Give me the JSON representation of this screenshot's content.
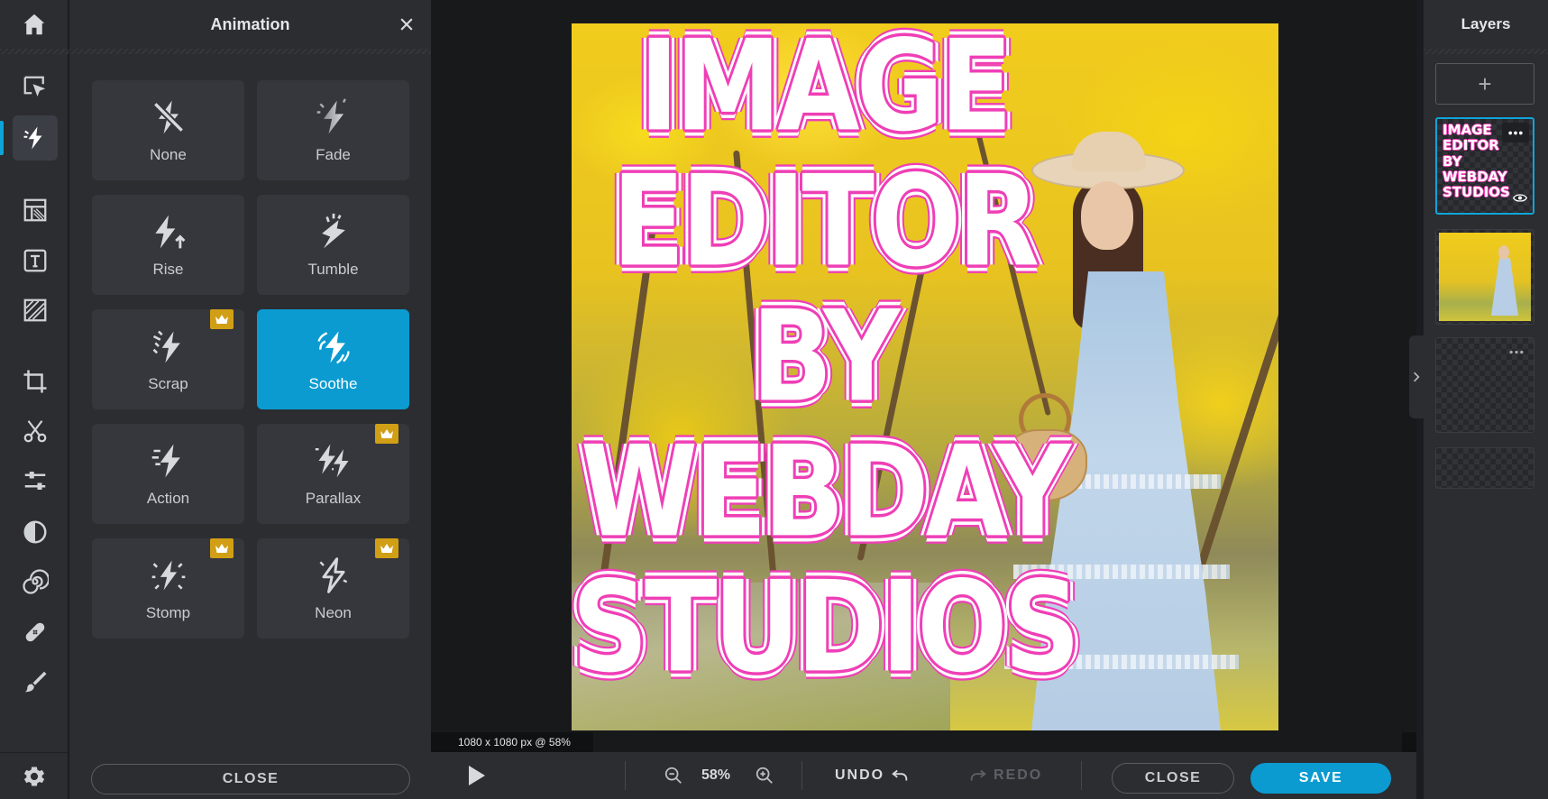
{
  "colors": {
    "accent": "#0b9bd1",
    "panel_bg": "#2b2d31",
    "card_bg": "#35373c",
    "premium_crown": "#d19f16",
    "text_magenta_outline": "#ef3fb6"
  },
  "toolbar": {
    "icons": [
      "home-icon",
      "select-arrange-icon",
      "animation-icon",
      "layout-icon",
      "text-icon",
      "overlay-icon",
      "crop-icon",
      "cutout-icon",
      "adjust-icon",
      "filter-icon",
      "effects-icon",
      "retouch-icon",
      "draw-icon",
      "settings-icon"
    ],
    "active": "animation-icon"
  },
  "panel": {
    "title": "Animation",
    "close_label": "CLOSE",
    "items": [
      {
        "label": "None",
        "premium": false,
        "selected": false
      },
      {
        "label": "Fade",
        "premium": false,
        "selected": false
      },
      {
        "label": "Rise",
        "premium": false,
        "selected": false
      },
      {
        "label": "Tumble",
        "premium": false,
        "selected": false
      },
      {
        "label": "Scrap",
        "premium": true,
        "selected": false
      },
      {
        "label": "Soothe",
        "premium": false,
        "selected": true
      },
      {
        "label": "Action",
        "premium": false,
        "selected": false
      },
      {
        "label": "Parallax",
        "premium": true,
        "selected": false
      },
      {
        "label": "Stomp",
        "premium": true,
        "selected": false
      },
      {
        "label": "Neon",
        "premium": true,
        "selected": false
      }
    ]
  },
  "canvas": {
    "overlay_lines": [
      "IMAGE",
      "EDITOR",
      "BY",
      "WEBDAY",
      "STUDIOS"
    ],
    "size_readout": "1080 x 1080 px @ 58%"
  },
  "bottombar": {
    "zoom_value": "58%",
    "undo_label": "UNDO",
    "redo_label": "REDO",
    "close_label": "CLOSE",
    "save_label": "SAVE"
  },
  "layers": {
    "title": "Layers",
    "add_label": "+",
    "thumb_text_lines": [
      "IMAGE",
      "EDITOR",
      "BY",
      "WEBDAY",
      "STUDIOS"
    ]
  }
}
